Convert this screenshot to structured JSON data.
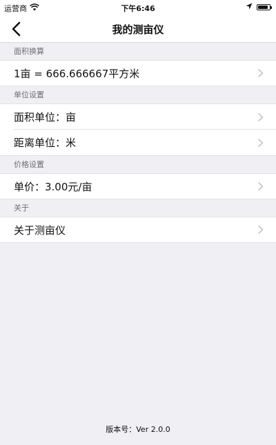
{
  "status_bar": {
    "carrier": "运营商",
    "time": "下午6:46",
    "battery_level": 0.9
  },
  "nav": {
    "title": "我的测亩仪"
  },
  "sections": {
    "area_conversion": {
      "header": "面积换算",
      "row": "1亩 = 666.666667平方米"
    },
    "unit_settings": {
      "header": "单位设置",
      "area_unit": "面积单位：亩",
      "distance_unit": "距离单位：米"
    },
    "price_settings": {
      "header": "价格设置",
      "unit_price": "单价：3.00元/亩"
    },
    "about": {
      "header": "关于",
      "row": "关于测亩仪"
    }
  },
  "footer": {
    "version": "版本号：Ver 2.0.0"
  }
}
